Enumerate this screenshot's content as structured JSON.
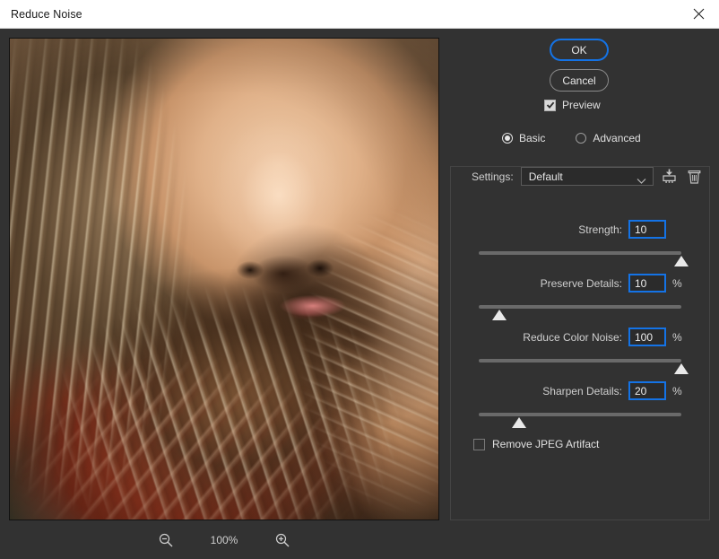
{
  "window": {
    "title": "Reduce Noise",
    "close_icon": "close-icon"
  },
  "preview": {
    "zoom_level": "100%",
    "zoom_out_icon": "zoom-out-icon",
    "zoom_in_icon": "zoom-in-icon",
    "image_description": "Close-up portrait of a bearded man, heavily smoothed by noise reduction"
  },
  "actions": {
    "ok_label": "OK",
    "cancel_label": "Cancel",
    "ok_focus_color": "#1473e6"
  },
  "options": {
    "preview_label": "Preview",
    "preview_checked": true,
    "mode_basic_label": "Basic",
    "mode_advanced_label": "Advanced",
    "mode_selected": "Basic"
  },
  "settings": {
    "label": "Settings:",
    "selected": "Default",
    "options": [
      "Default"
    ],
    "save_icon": "save-preset-icon",
    "delete_icon": "trash-icon"
  },
  "sliders": [
    {
      "name": "strength",
      "label": "Strength:",
      "value": "10",
      "unit": "",
      "min": 0,
      "max": 10,
      "percent": 100
    },
    {
      "name": "preserve-details",
      "label": "Preserve Details:",
      "value": "10",
      "unit": "%",
      "min": 0,
      "max": 100,
      "percent": 10
    },
    {
      "name": "reduce-color-noise",
      "label": "Reduce Color Noise:",
      "value": "100",
      "unit": "%",
      "min": 0,
      "max": 100,
      "percent": 100
    },
    {
      "name": "sharpen-details",
      "label": "Sharpen Details:",
      "value": "20",
      "unit": "%",
      "min": 0,
      "max": 100,
      "percent": 20
    }
  ],
  "jpeg": {
    "label": "Remove JPEG Artifact",
    "checked": false
  },
  "colors": {
    "dialog_bg": "#323232",
    "titlebar_bg": "#ffffff",
    "accent_blue": "#1473e6",
    "text": "#e0e0e0"
  }
}
